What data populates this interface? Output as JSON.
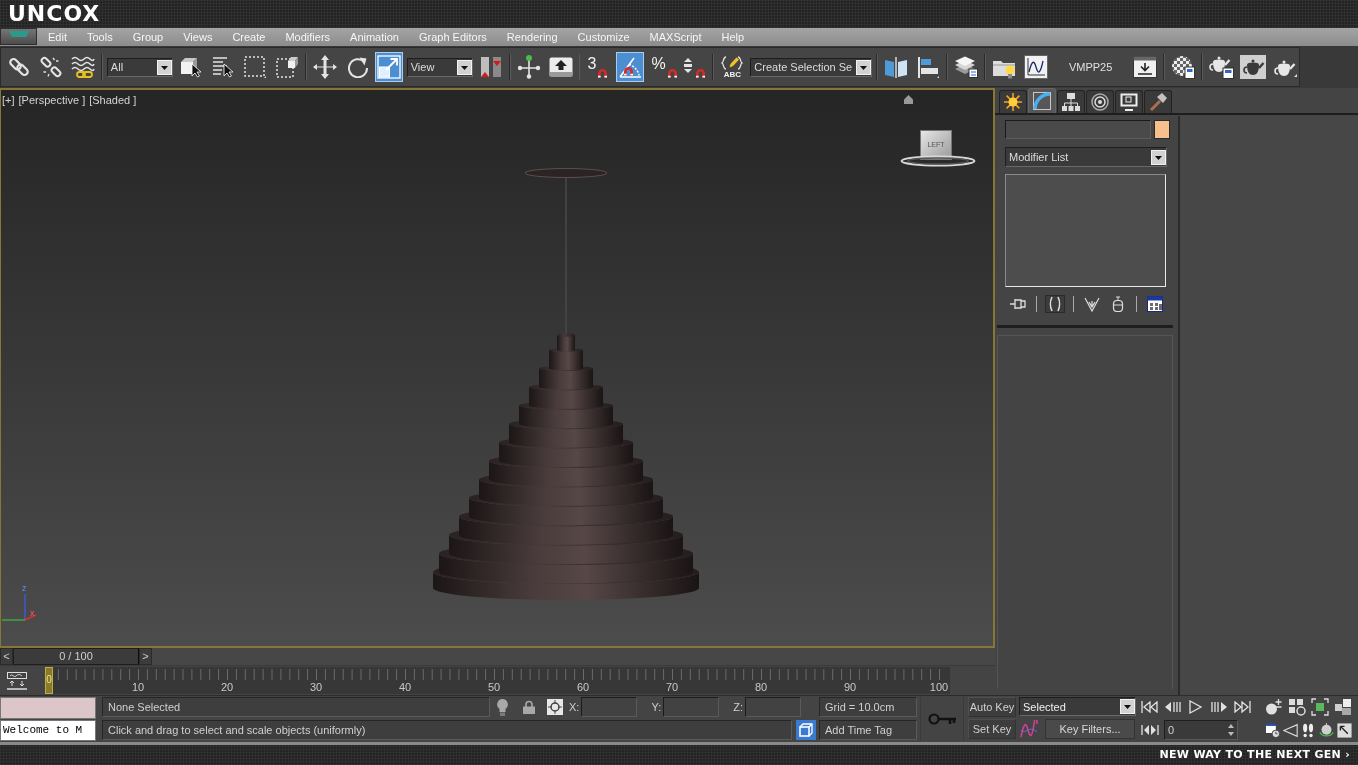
{
  "top_banner": {
    "logo": "UNCOX"
  },
  "menu_bar": {
    "items": [
      "Edit",
      "Tools",
      "Group",
      "Views",
      "Create",
      "Modifiers",
      "Animation",
      "Graph Editors",
      "Rendering",
      "Customize",
      "MAXScript",
      "Help"
    ]
  },
  "toolbar": {
    "groups": [
      {
        "items": [
          {
            "kind": "button",
            "selected": false
          },
          {
            "kind": "button",
            "selected": false
          },
          {
            "kind": "button",
            "selected": false
          }
        ]
      },
      {
        "items": [
          {
            "kind": "dropdown",
            "value": "All"
          },
          {
            "kind": "button",
            "selected": false
          },
          {
            "kind": "button",
            "selected": false
          },
          {
            "kind": "button",
            "selected": false
          },
          {
            "kind": "button",
            "selected": false
          }
        ]
      },
      {
        "items": [
          {
            "kind": "button",
            "selected": false
          },
          {
            "kind": "button",
            "selected": false
          },
          {
            "kind": "button",
            "selected": true
          },
          {
            "kind": "dropdown",
            "value": "View"
          },
          {
            "kind": "button",
            "selected": false
          }
        ]
      },
      {
        "items": [
          {
            "kind": "button",
            "selected": false
          },
          {
            "kind": "button",
            "selected": false
          }
        ]
      },
      {
        "items": [
          {
            "kind": "button",
            "selected": false,
            "glyph": "3"
          },
          {
            "kind": "button",
            "selected": true
          },
          {
            "kind": "button",
            "selected": false,
            "glyph": "%"
          },
          {
            "kind": "button",
            "selected": false
          }
        ]
      },
      {
        "items": [
          {
            "kind": "button",
            "selected": false,
            "glyph": "ABC"
          },
          {
            "kind": "dropdown",
            "value": "Create Selection Se"
          }
        ]
      },
      {
        "items": [
          {
            "kind": "button",
            "selected": false
          },
          {
            "kind": "button",
            "selected": false
          }
        ]
      },
      {
        "items": [
          {
            "kind": "button",
            "selected": false
          }
        ]
      },
      {
        "items": [
          {
            "kind": "button",
            "selected": false
          },
          {
            "kind": "button",
            "selected": false
          },
          {
            "kind": "label",
            "text": "VMPP25"
          },
          {
            "kind": "button",
            "selected": false
          }
        ]
      },
      {
        "items": [
          {
            "kind": "button",
            "selected": false
          }
        ]
      },
      {
        "items": [
          {
            "kind": "button",
            "selected": false
          },
          {
            "kind": "button",
            "selected": false
          },
          {
            "kind": "button",
            "selected": false
          }
        ]
      }
    ]
  },
  "viewport": {
    "labels": [
      "[+]",
      "[Perspective ]",
      "[Shaded ]"
    ],
    "viewcube_face": "LEFT",
    "axis_labels": [
      "z",
      "x"
    ]
  },
  "command_panel": {
    "tabs": [
      {
        "selected": false
      },
      {
        "selected": true
      },
      {
        "selected": false
      },
      {
        "selected": false
      },
      {
        "selected": false
      },
      {
        "selected": false
      }
    ],
    "modifier_list": "Modifier List",
    "stack_tools": [
      {
        "buttons": [
          {
            "on": false
          }
        ]
      },
      {
        "buttons": [
          {
            "on": true
          }
        ]
      },
      {
        "buttons": [
          {
            "on": false
          },
          {
            "on": false
          }
        ]
      },
      {
        "buttons": [
          {
            "on": false
          }
        ]
      }
    ]
  },
  "time_slider": {
    "label": "0 / 100",
    "level": 0,
    "previous": "<",
    "next": ">"
  },
  "track_bar": {
    "current_frame": "0",
    "labels": [
      "10",
      "20",
      "30",
      "40",
      "50",
      "60",
      "70",
      "80",
      "90",
      "100"
    ]
  },
  "status_bar": {
    "listener_output": "Welcome to M",
    "selection": "None Selected",
    "coordinates": [
      "X:",
      "Y:",
      "Z:"
    ],
    "grid": "Grid = 10.0cm",
    "prompt": "Click and drag to select and scale objects (uniformly)",
    "time_tag": "Add Time Tag"
  },
  "animation_controls": {
    "auto_key": "Auto Key",
    "key_set": "Selected",
    "set_key": "Set Key",
    "key_filters": "Key Filters...",
    "frame": "0"
  },
  "bottom_banner": {
    "tagline": "NEW WAY TO THE NEXT GEN ›"
  }
}
